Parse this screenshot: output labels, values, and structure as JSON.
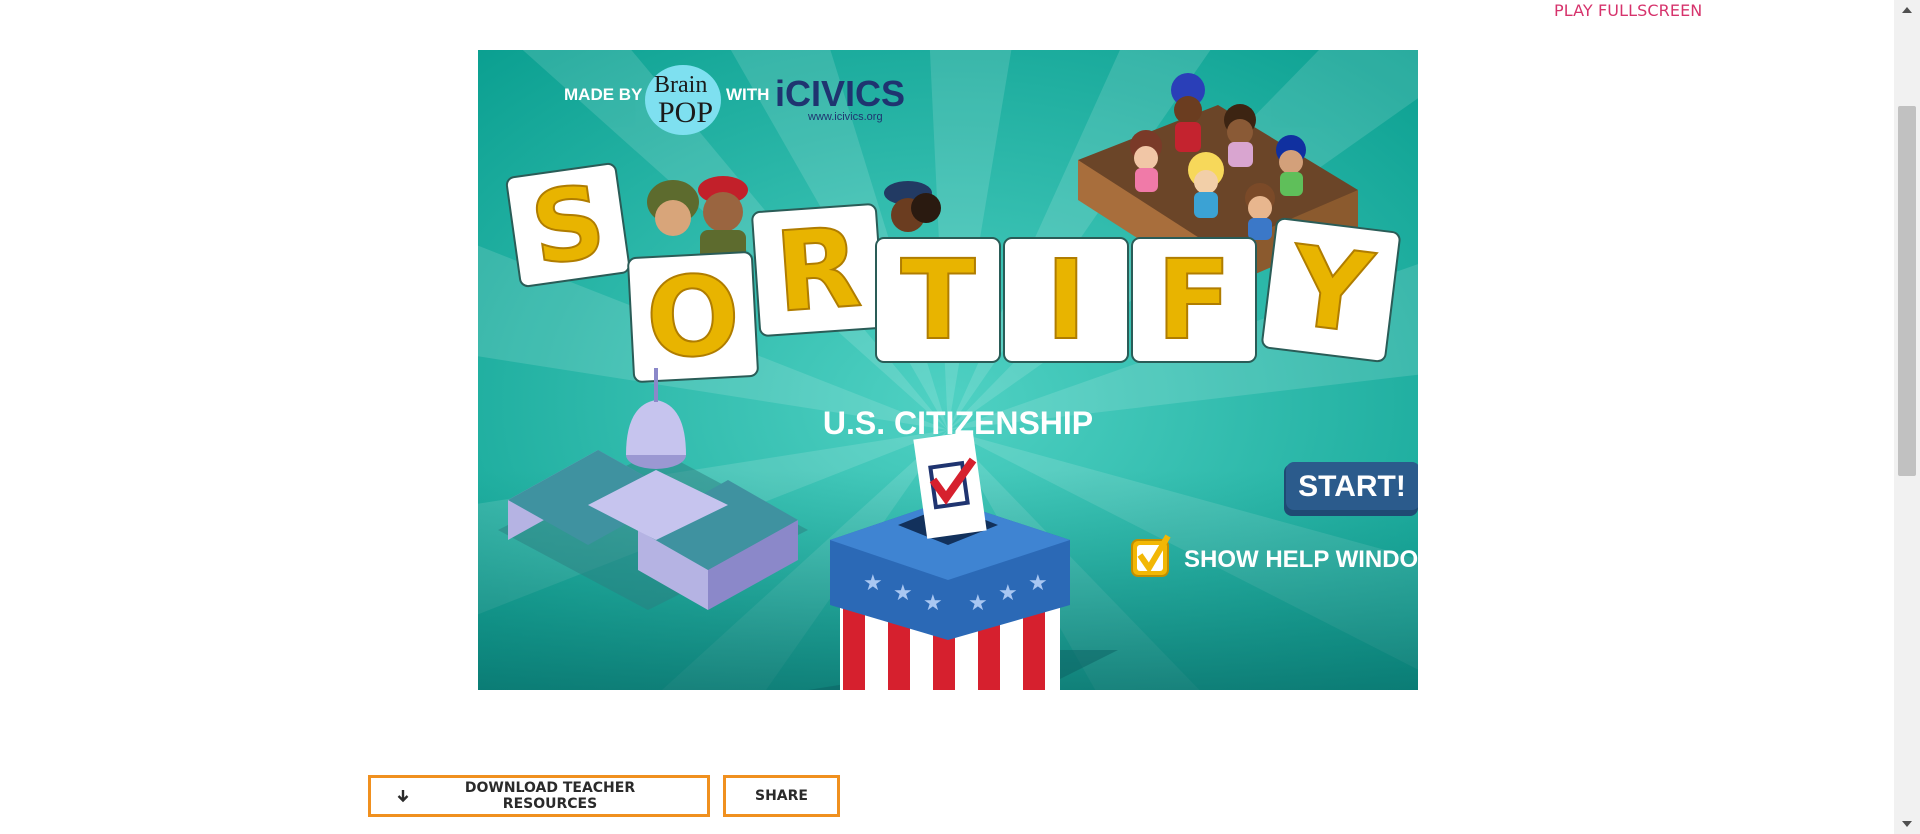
{
  "header": {
    "play_fullscreen": "PLAY FULLSCREEN"
  },
  "game": {
    "made_by": "MADE BY",
    "brainpop_line1": "Brain",
    "brainpop_line2": "POP",
    "with": "WITH",
    "icivics": "iCIVICS",
    "icivics_url": "www.icivics.org",
    "title_letters": [
      "S",
      "O",
      "R",
      "T",
      "I",
      "F",
      "Y"
    ],
    "subtitle": "U.S. CITIZENSHIP",
    "start": "START!",
    "help_label": "SHOW HELP WINDOWS?",
    "help_checked": true
  },
  "actions": {
    "download_label": "DOWNLOAD TEACHER RESOURCES",
    "share_label": "SHARE"
  },
  "colors": {
    "accent_pink": "#d6336c",
    "button_border": "#f0901f",
    "game_teal": "#12a99a",
    "tile_letter_yellow": "#e8b400",
    "start_blue": "#2b5b8c"
  },
  "icons": [
    "download-arrow-icon",
    "checkbox-check-icon",
    "scroll-up-icon",
    "scroll-down-icon"
  ]
}
